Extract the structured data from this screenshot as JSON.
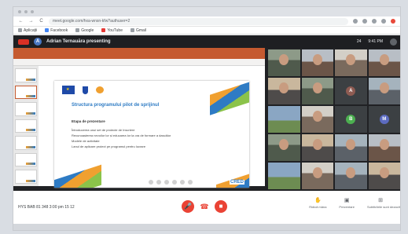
{
  "browser": {
    "nav": {
      "back": "←",
      "forward": "→",
      "reload": "C"
    },
    "url": "meet.google.com/hxa-wnsn-kfw?authuser=2",
    "bookmarks": [
      {
        "label": "Aplicații",
        "icon": "apps-icon"
      },
      {
        "label": "Facebook",
        "icon": "facebook-icon"
      },
      {
        "label": "Google",
        "icon": "google-icon"
      },
      {
        "label": "YouTube",
        "icon": "youtube-icon"
      },
      {
        "label": "Gmail",
        "icon": "gmail-icon"
      }
    ]
  },
  "meet": {
    "presenter_initial": "A",
    "presenting_text": "Adrian Ternauăra presenting",
    "header_right": [
      "24",
      "9:41 PM"
    ],
    "slide": {
      "title": "Structura programului pilot de sprijinul",
      "subtitle": "Etapa de prezentare",
      "bullets": [
        "Întroducerea unui set de proiecte de înscriere",
        "Recunoașterea nevoilor lor și educarea lor la ora de formare a dascălor",
        "Modele de activitate",
        "Lanul de aplicare proiect pe programul pentru lucrare"
      ],
      "logo_text": "CRED"
    },
    "tiles": [
      {
        "type": "cam",
        "style": "cam1"
      },
      {
        "type": "cam",
        "style": "cam2"
      },
      {
        "type": "cam",
        "style": "cam3"
      },
      {
        "type": "cam",
        "style": "cam2"
      },
      {
        "type": "cam",
        "style": "cam5"
      },
      {
        "type": "cam",
        "style": "cam1"
      },
      {
        "type": "avatar",
        "initial": "A",
        "color": "#8e5b52"
      },
      {
        "type": "cam",
        "style": "cam6"
      },
      {
        "type": "cam",
        "style": "cam4"
      },
      {
        "type": "cam",
        "style": "cam3"
      },
      {
        "type": "avatar",
        "initial": "B",
        "color": "#4caf50"
      },
      {
        "type": "avatar",
        "initial": "M",
        "color": "#5c6bc0"
      },
      {
        "type": "cam",
        "style": "cam1"
      },
      {
        "type": "cam",
        "style": "cam5"
      },
      {
        "type": "cam",
        "style": "cam6"
      },
      {
        "type": "cam",
        "style": "cam2"
      },
      {
        "type": "cam",
        "style": "cam4"
      },
      {
        "type": "cam",
        "style": "cam3"
      },
      {
        "type": "cam",
        "style": "cam6"
      },
      {
        "type": "cam",
        "style": "cam5"
      }
    ],
    "meeting_info": "HYS BAB 81 348 3:00 pm 15 12",
    "controls": {
      "mic": "🎤",
      "hangup": "☎",
      "camera": "■"
    },
    "right_controls": [
      {
        "icon": "✋",
        "label": "Ridică mâna"
      },
      {
        "icon": "▣",
        "label": "Prezentare"
      },
      {
        "icon": "⊞",
        "label": "Subtitrările sunt dezactivate"
      }
    ]
  },
  "colors": {
    "accent_red": "#ea4335",
    "ppt_ribbon": "#c55a30",
    "meet_bg": "#202124"
  }
}
